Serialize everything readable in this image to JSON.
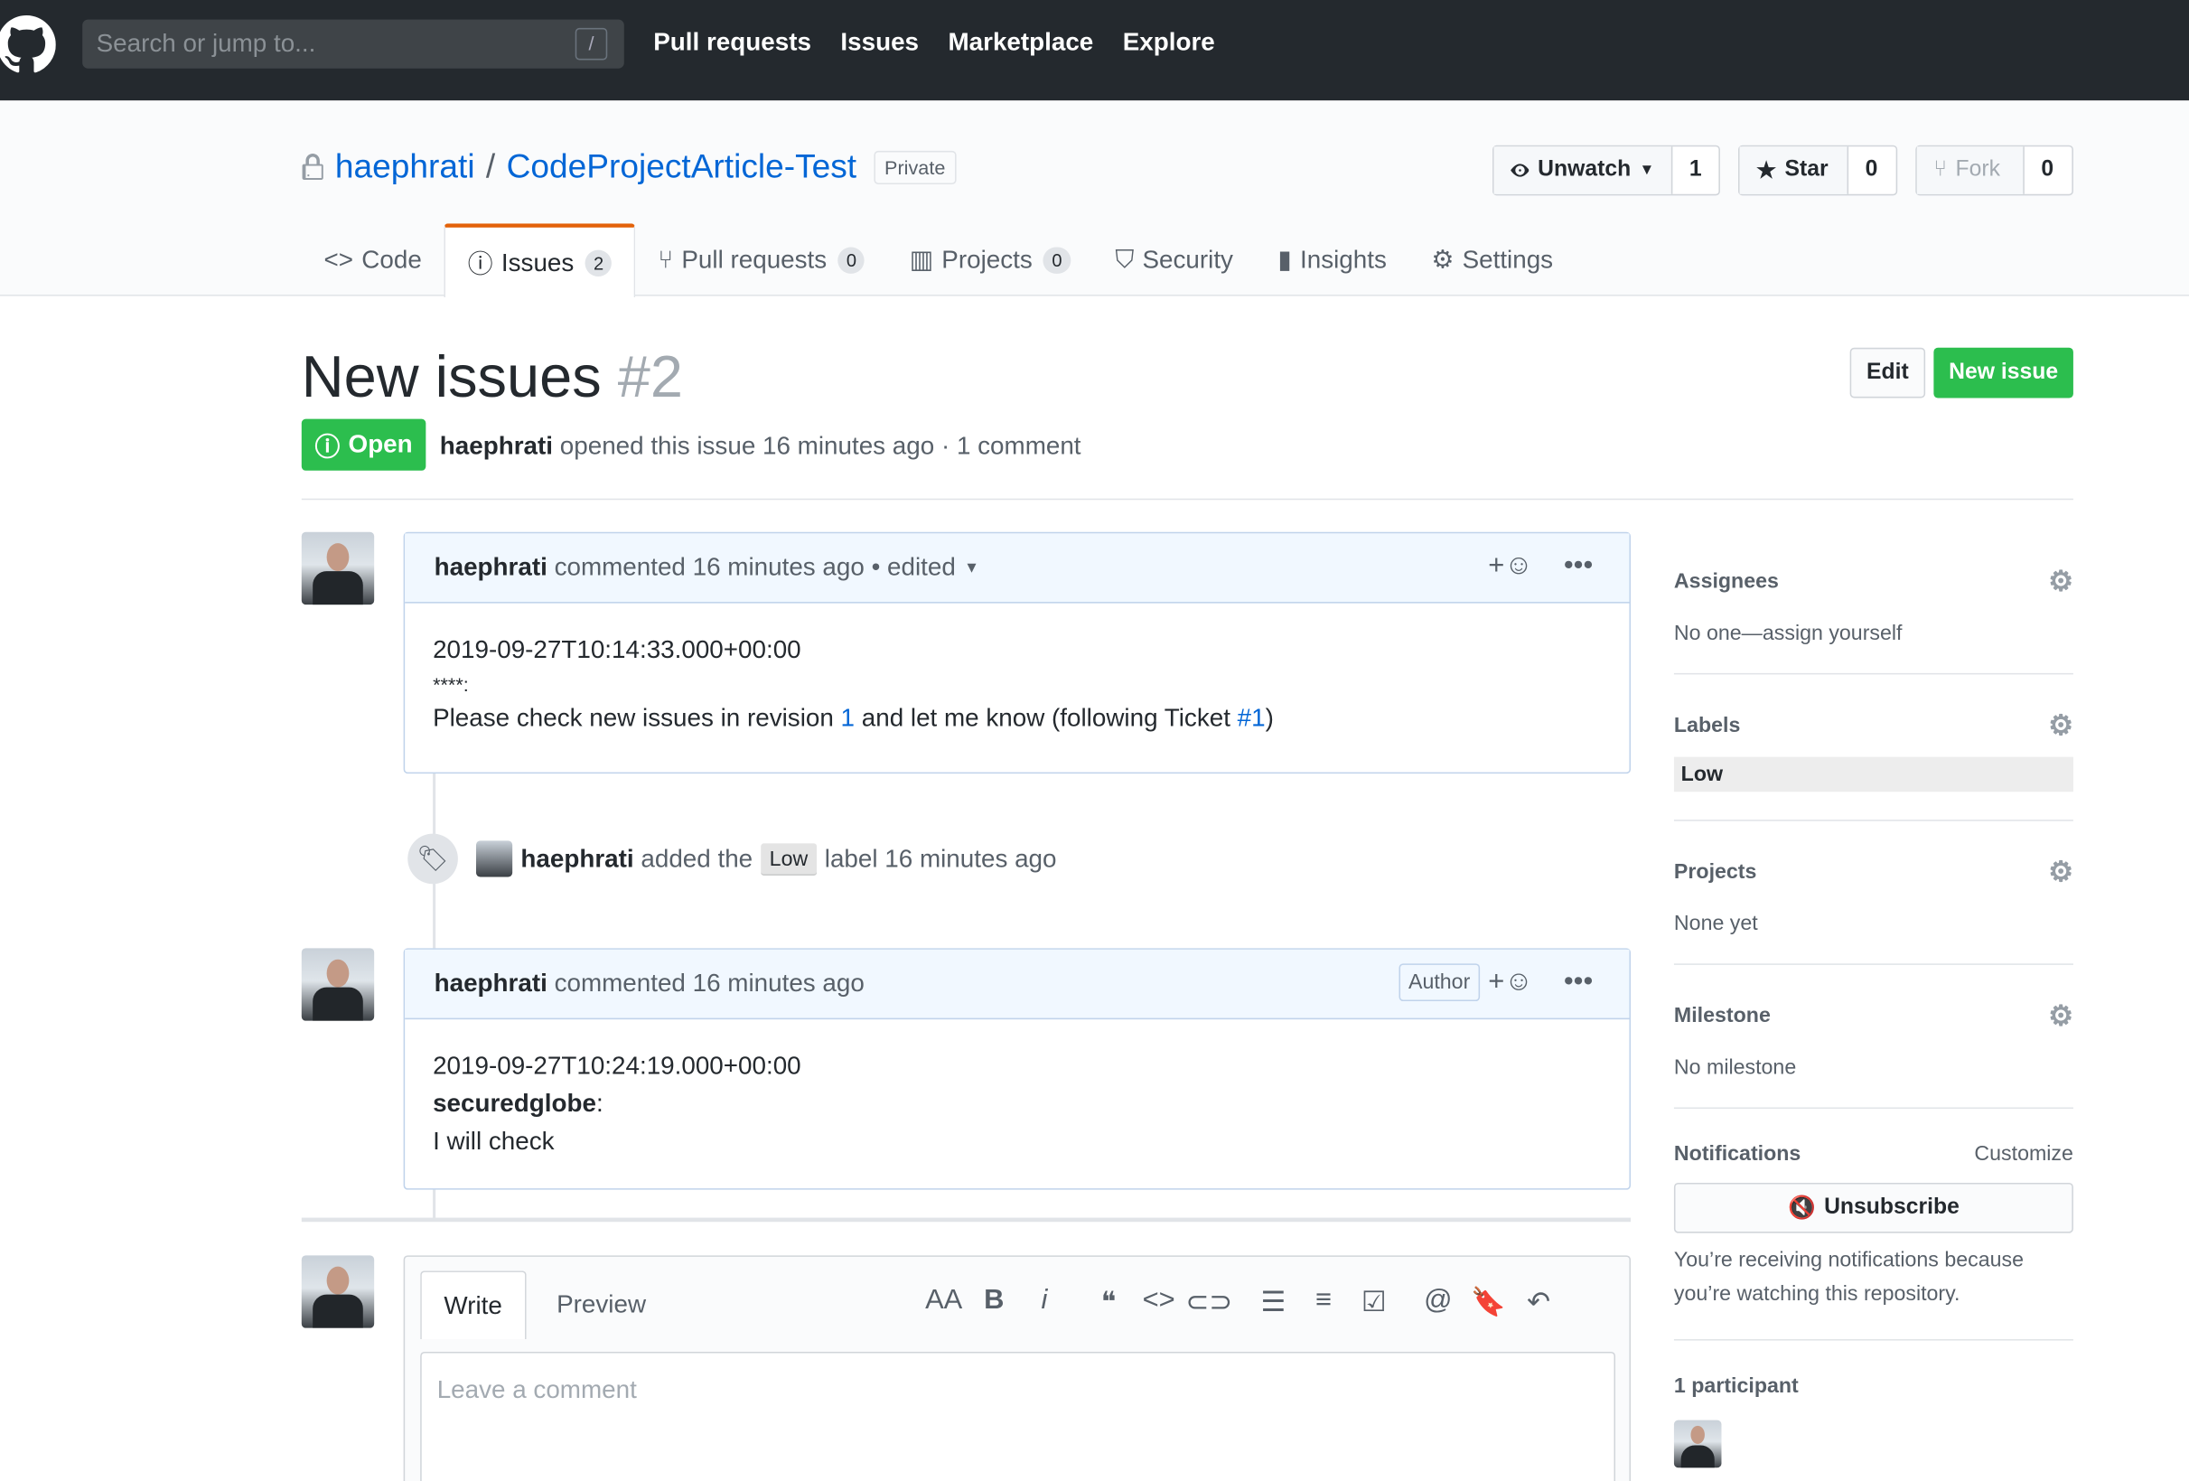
{
  "header": {
    "search_placeholder": "Search or jump to...",
    "slash_hint": "/",
    "nav": [
      "Pull requests",
      "Issues",
      "Marketplace",
      "Explore"
    ]
  },
  "repo": {
    "owner": "haephrati",
    "separator": "/",
    "name": "CodeProjectArticle-Test",
    "visibility": "Private",
    "watch_label": "Unwatch",
    "watch_count": "1",
    "star_label": "Star",
    "star_count": "0",
    "fork_label": "Fork",
    "fork_count": "0"
  },
  "tabs": [
    {
      "label": "Code",
      "count": ""
    },
    {
      "label": "Issues",
      "count": "2"
    },
    {
      "label": "Pull requests",
      "count": "0"
    },
    {
      "label": "Projects",
      "count": "0"
    },
    {
      "label": "Security",
      "count": ""
    },
    {
      "label": "Insights",
      "count": ""
    },
    {
      "label": "Settings",
      "count": ""
    }
  ],
  "issue": {
    "title": "New issues",
    "number": "#2",
    "edit_label": "Edit",
    "new_issue_label": "New issue",
    "state": "Open",
    "author": "haephrati",
    "meta_text": "opened this issue 16 minutes ago · 1 comment"
  },
  "comments": [
    {
      "author": "haephrati",
      "header_text": "commented 16 minutes ago • edited",
      "line1": "2019-09-27T10:14:33.000+00:00",
      "line2": "****:",
      "line3_pre": "Please check new issues in revision ",
      "line3_link1": "1",
      "line3_mid": " and let me know (following Ticket ",
      "line3_link2": "#1",
      "line3_post": ")"
    },
    {
      "author": "haephrati",
      "header_text": "commented 16 minutes ago",
      "badge": "Author",
      "line1": "2019-09-27T10:24:19.000+00:00",
      "line2_bold": "securedglobe",
      "line2_rest": ":",
      "line3": "I will check"
    }
  ],
  "event": {
    "actor": "haephrati",
    "pre": "added the",
    "label": "Low",
    "post": "label 16 minutes ago"
  },
  "editor": {
    "write_tab": "Write",
    "preview_tab": "Preview",
    "placeholder": "Leave a comment"
  },
  "sidebar": {
    "assignees_title": "Assignees",
    "assignees_value": "No one—assign yourself",
    "labels_title": "Labels",
    "labels_value": "Low",
    "projects_title": "Projects",
    "projects_value": "None yet",
    "milestone_title": "Milestone",
    "milestone_value": "No milestone",
    "notifications_title": "Notifications",
    "customize": "Customize",
    "unsubscribe": "Unsubscribe",
    "notifications_note": "You’re receiving notifications because you’re watching this repository.",
    "participants": "1 participant"
  },
  "colors": {
    "header_bg": "#24292e",
    "link": "#0366d6",
    "green": "#2cbe4e",
    "tab_accent": "#e36209"
  }
}
